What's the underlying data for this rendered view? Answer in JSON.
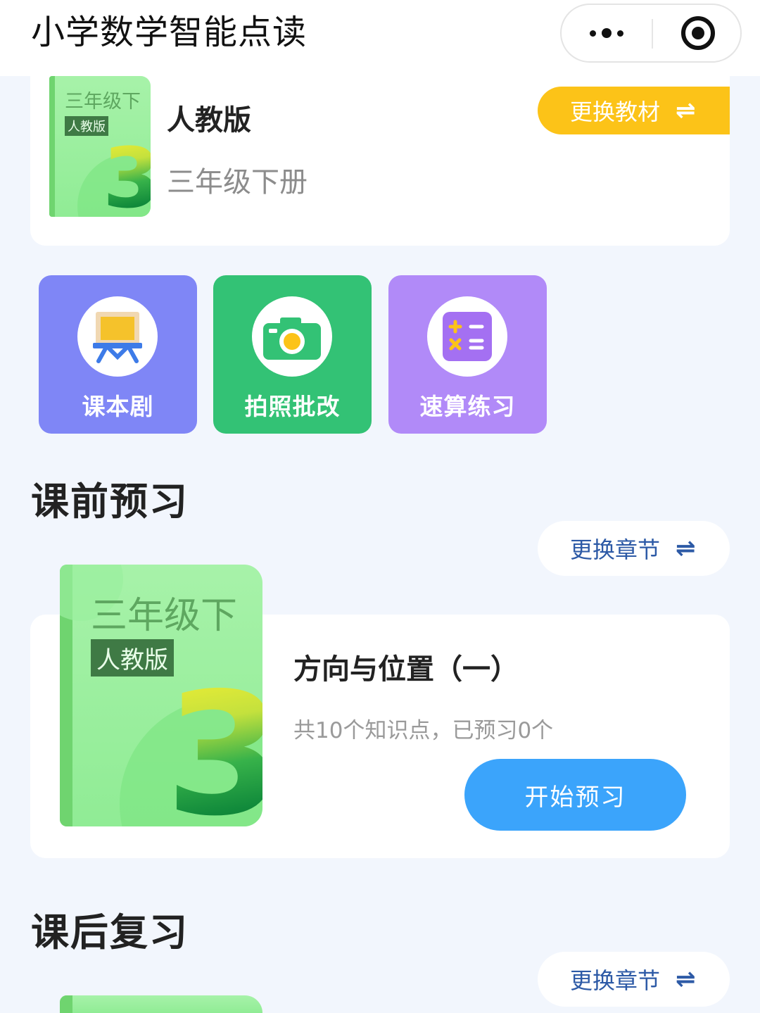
{
  "header": {
    "title": "小学数学智能点读",
    "more_icon": "more-dots-icon",
    "close_icon": "target-close-icon"
  },
  "textbook": {
    "cover_grade": "三年级下",
    "cover_edition": "人教版",
    "cover_number": "3",
    "edition": "人教版",
    "grade": "三年级下册",
    "change_label": "更换教材",
    "change_icon": "⇌"
  },
  "tools": [
    {
      "label": "课本剧",
      "icon": "stage-board-icon",
      "color": "#7f86f6"
    },
    {
      "label": "拍照批改",
      "icon": "camera-icon",
      "color": "#33c275"
    },
    {
      "label": "速算练习",
      "icon": "calculator-icon",
      "color": "#b18af8"
    }
  ],
  "preview": {
    "section_title": "课前预习",
    "change_chapter_label": "更换章节",
    "change_icon": "⇌",
    "cover_grade": "三年级下",
    "cover_edition": "人教版",
    "cover_number": "3",
    "lesson_title": "方向与位置（一）",
    "lesson_info": "共10个知识点，已预习0个",
    "start_label": "开始预习"
  },
  "review": {
    "section_title": "课后复习",
    "change_chapter_label": "更换章节",
    "change_icon": "⇌"
  },
  "colors": {
    "accent_yellow": "#fcc318",
    "accent_blue": "#3ba4fb",
    "link_blue": "#2d5aa6",
    "background": "#f2f6fd"
  }
}
